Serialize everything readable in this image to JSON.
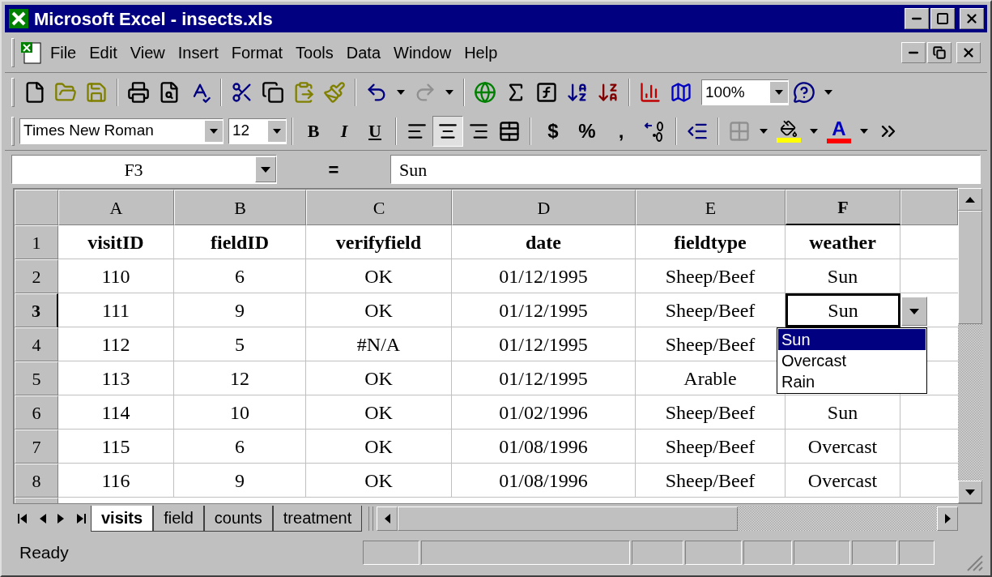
{
  "window": {
    "title": "Microsoft Excel - insects.xls"
  },
  "menu": [
    "File",
    "Edit",
    "View",
    "Insert",
    "Format",
    "Tools",
    "Data",
    "Window",
    "Help"
  ],
  "standard_toolbar": {
    "zoom": "100%"
  },
  "formatting_toolbar": {
    "font": "Times New Roman",
    "size": "12",
    "styles": [
      "B",
      "I",
      "U"
    ],
    "alignments": [
      {
        "selected": false
      },
      {
        "selected": true
      },
      {
        "selected": false
      }
    ],
    "number_formats": [
      "$",
      "%",
      ","
    ],
    "font_color_label": "A"
  },
  "formula_bar": {
    "name_box": "F3",
    "equals": "=",
    "value": "Sun"
  },
  "sheet": {
    "columns": [
      {
        "label": "A",
        "selected": false
      },
      {
        "label": "B",
        "selected": false
      },
      {
        "label": "C",
        "selected": false
      },
      {
        "label": "D",
        "selected": false
      },
      {
        "label": "E",
        "selected": false
      },
      {
        "label": "F",
        "selected": true
      }
    ],
    "rows": [
      {
        "number": "1",
        "selected": false,
        "kind": "heading",
        "cells": [
          "visitID",
          "fieldID",
          "verifyfield",
          "date",
          "fieldtype",
          "weather"
        ]
      },
      {
        "number": "2",
        "selected": false,
        "kind": "data",
        "cells": [
          "110",
          "6",
          "OK",
          "01/12/1995",
          "Sheep/Beef",
          "Sun"
        ]
      },
      {
        "number": "3",
        "selected": true,
        "kind": "data",
        "cells": [
          "111",
          "9",
          "OK",
          "01/12/1995",
          "Sheep/Beef",
          "Sun"
        ]
      },
      {
        "number": "4",
        "selected": false,
        "kind": "data",
        "cells": [
          "112",
          "5",
          "#N/A",
          "01/12/1995",
          "Sheep/Beef"
        ]
      },
      {
        "number": "5",
        "selected": false,
        "kind": "data",
        "cells": [
          "113",
          "12",
          "OK",
          "01/12/1995",
          "Arable"
        ]
      },
      {
        "number": "6",
        "selected": false,
        "kind": "data",
        "cells": [
          "114",
          "10",
          "OK",
          "01/02/1996",
          "Sheep/Beef",
          "Sun"
        ]
      },
      {
        "number": "7",
        "selected": false,
        "kind": "data",
        "cells": [
          "115",
          "6",
          "OK",
          "01/08/1996",
          "Sheep/Beef",
          "Overcast"
        ]
      },
      {
        "number": "8",
        "selected": false,
        "kind": "data",
        "cells": [
          "116",
          "9",
          "OK",
          "01/08/1996",
          "Sheep/Beef",
          "Overcast"
        ]
      }
    ],
    "validation_list": [
      {
        "label": "Sun",
        "selected": true
      },
      {
        "label": "Overcast",
        "selected": false
      },
      {
        "label": "Rain",
        "selected": false
      }
    ]
  },
  "sheet_tabs": [
    {
      "label": "visits",
      "selected": true
    },
    {
      "label": "field",
      "selected": false
    },
    {
      "label": "counts",
      "selected": false
    },
    {
      "label": "treatment",
      "selected": false
    }
  ],
  "status_bar": {
    "text": "Ready"
  }
}
